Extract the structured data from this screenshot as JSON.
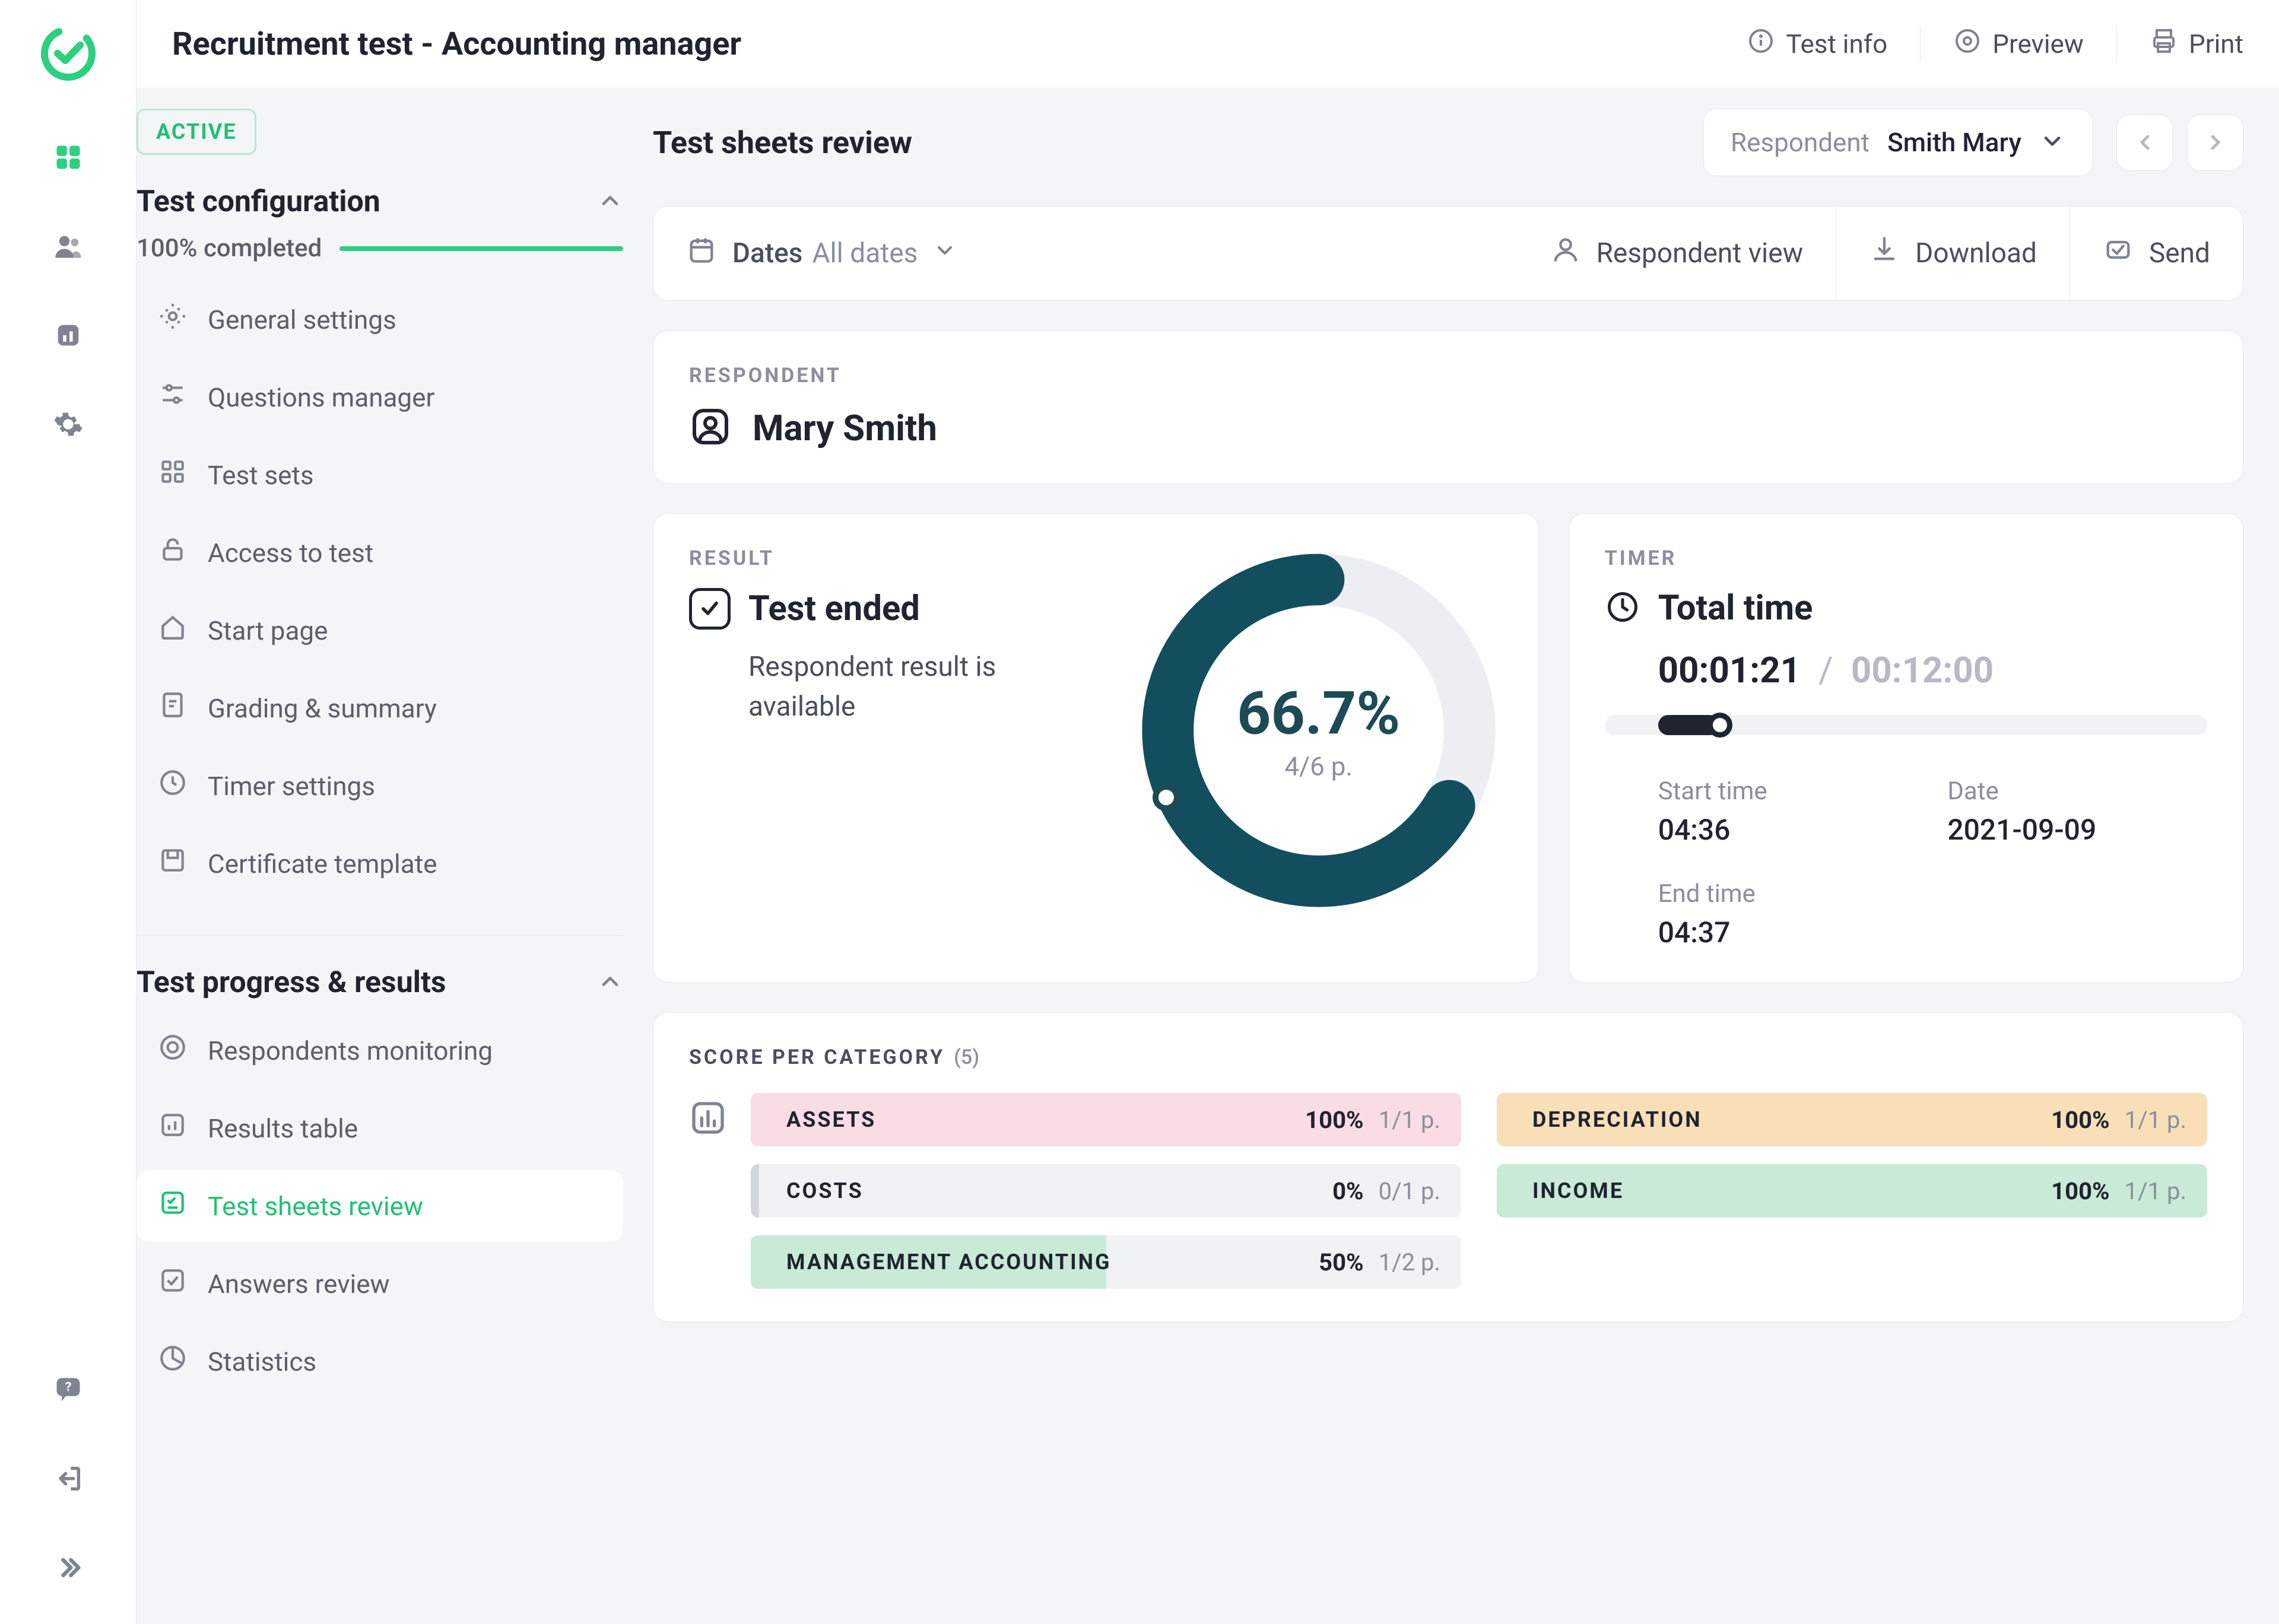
{
  "chart_data": {
    "donut": {
      "type": "pie",
      "title": "Result",
      "percent": 66.7,
      "points": "4/6 p."
    },
    "score_per_category": {
      "type": "bar",
      "series": [
        {
          "name": "ASSETS",
          "percent": 100,
          "points": "1/1 p."
        },
        {
          "name": "COSTS",
          "percent": 0,
          "points": "0/1 p."
        },
        {
          "name": "MANAGEMENT ACCOUNTING",
          "percent": 50,
          "points": "1/2 p."
        },
        {
          "name": "DEPRECIATION",
          "percent": 100,
          "points": "1/1 p."
        },
        {
          "name": "INCOME",
          "percent": 100,
          "points": "1/1 p."
        }
      ]
    }
  },
  "header": {
    "title": "Recruitment test - Accounting manager",
    "actions": {
      "test_info": "Test info",
      "preview": "Preview",
      "print": "Print"
    }
  },
  "sidebar": {
    "status": "ACTIVE",
    "section1": {
      "title": "Test configuration",
      "progress_label": "100% completed",
      "items": [
        "General settings",
        "Questions manager",
        "Test sets",
        "Access to test",
        "Start page",
        "Grading & summary",
        "Timer settings",
        "Certificate template"
      ]
    },
    "section2": {
      "title": "Test progress & results",
      "items": [
        "Respondents monitoring",
        "Results table",
        "Test sheets review",
        "Answers review",
        "Statistics"
      ]
    }
  },
  "content": {
    "title": "Test sheets review",
    "respondent_select": {
      "label": "Respondent",
      "value": "Smith Mary"
    },
    "toolbar": {
      "dates_label": "Dates",
      "dates_value": "All dates",
      "respondent_view": "Respondent view",
      "download": "Download",
      "send": "Send"
    },
    "respondent_card": {
      "eyebrow": "RESPONDENT",
      "name": "Mary Smith"
    },
    "result_card": {
      "eyebrow": "RESULT",
      "title": "Test ended",
      "subtitle": "Respondent result is available",
      "percent": "66.7%",
      "points": "4/6 p."
    },
    "timer_card": {
      "eyebrow": "TIMER",
      "title": "Total time",
      "elapsed": "00:01:21",
      "total": "00:12:00",
      "start_time_label": "Start time",
      "start_time": "04:36",
      "date_label": "Date",
      "date": "2021-09-09",
      "end_time_label": "End time",
      "end_time": "04:37"
    },
    "score_card": {
      "title": "SCORE PER CATEGORY",
      "count": "(5)",
      "rows": [
        {
          "name": "ASSETS",
          "percent": "100%",
          "points": "1/1 p."
        },
        {
          "name": "COSTS",
          "percent": "0%",
          "points": "0/1 p."
        },
        {
          "name": "MANAGEMENT ACCOUNTING",
          "percent": "50%",
          "points": "1/2 p."
        },
        {
          "name": "DEPRECIATION",
          "percent": "100%",
          "points": "1/1 p."
        },
        {
          "name": "INCOME",
          "percent": "100%",
          "points": "1/1 p."
        }
      ]
    }
  }
}
